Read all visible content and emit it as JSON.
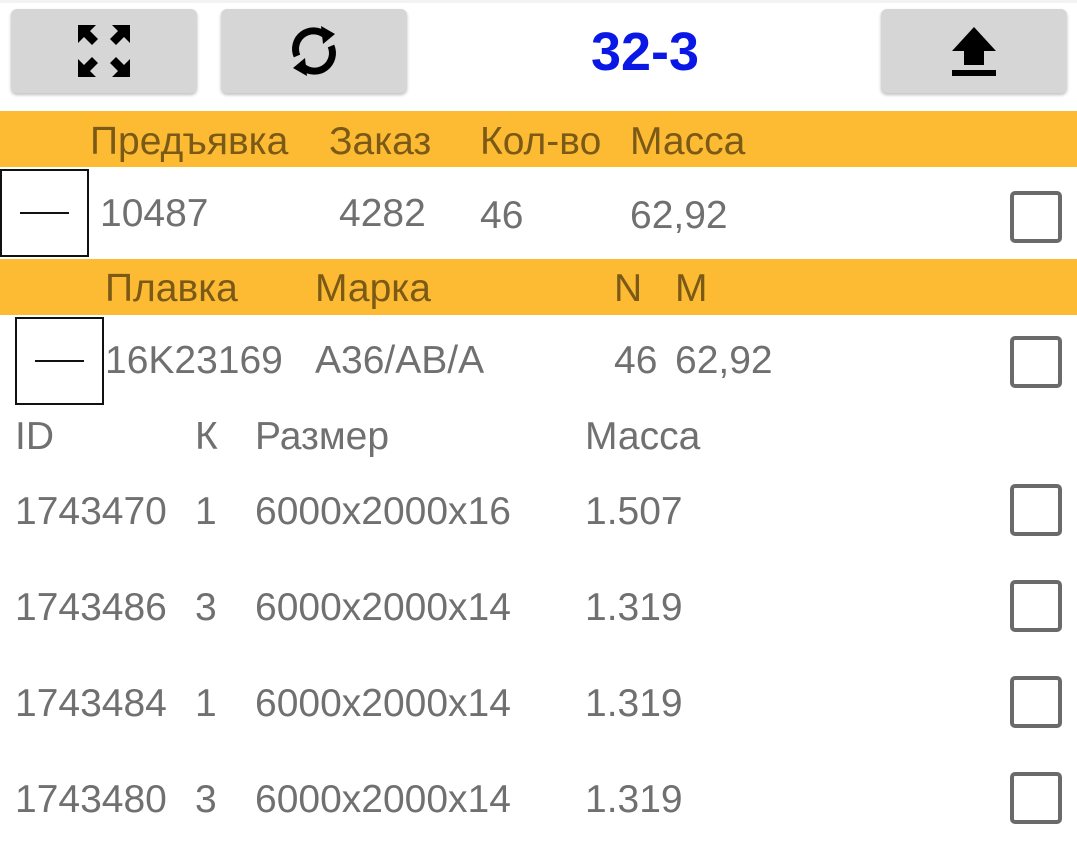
{
  "toolbar": {
    "expand_icon": "expand-arrows-icon",
    "refresh_icon": "refresh-icon",
    "title": "32-3",
    "upload_icon": "upload-icon",
    "title_color": "#0a18e6"
  },
  "colors": {
    "header_band": "#fdbb34",
    "header_text": "#7b5a17",
    "row_text": "#707070",
    "button_bg": "#d6d6d6"
  },
  "submission": {
    "headers": {
      "presentation": "Предъявка",
      "order": "Заказ",
      "quantity": "Кол-во",
      "mass": "Масса"
    },
    "row": {
      "presentation": "10487",
      "order": "4282",
      "quantity": "46",
      "mass": "62,92",
      "checked": false
    }
  },
  "heat": {
    "headers": {
      "heat": "Плавка",
      "grade": "Марка",
      "n": "N",
      "m": "M"
    },
    "row": {
      "heat": "16K23169",
      "grade": "A36/AB/A",
      "n": "46",
      "m": "62,92",
      "checked": false
    }
  },
  "items": {
    "headers": {
      "id": "ID",
      "k": "К",
      "size": "Размер",
      "mass": "Масса"
    },
    "rows": [
      {
        "id": "1743470",
        "k": "1",
        "size": "6000x2000x16",
        "mass": "1.507",
        "checked": false
      },
      {
        "id": "1743486",
        "k": "3",
        "size": "6000x2000x14",
        "mass": "1.319",
        "checked": false
      },
      {
        "id": "1743484",
        "k": "1",
        "size": "6000x2000x14",
        "mass": "1.319",
        "checked": false
      },
      {
        "id": "1743480",
        "k": "3",
        "size": "6000x2000x14",
        "mass": "1.319",
        "checked": false
      }
    ]
  }
}
